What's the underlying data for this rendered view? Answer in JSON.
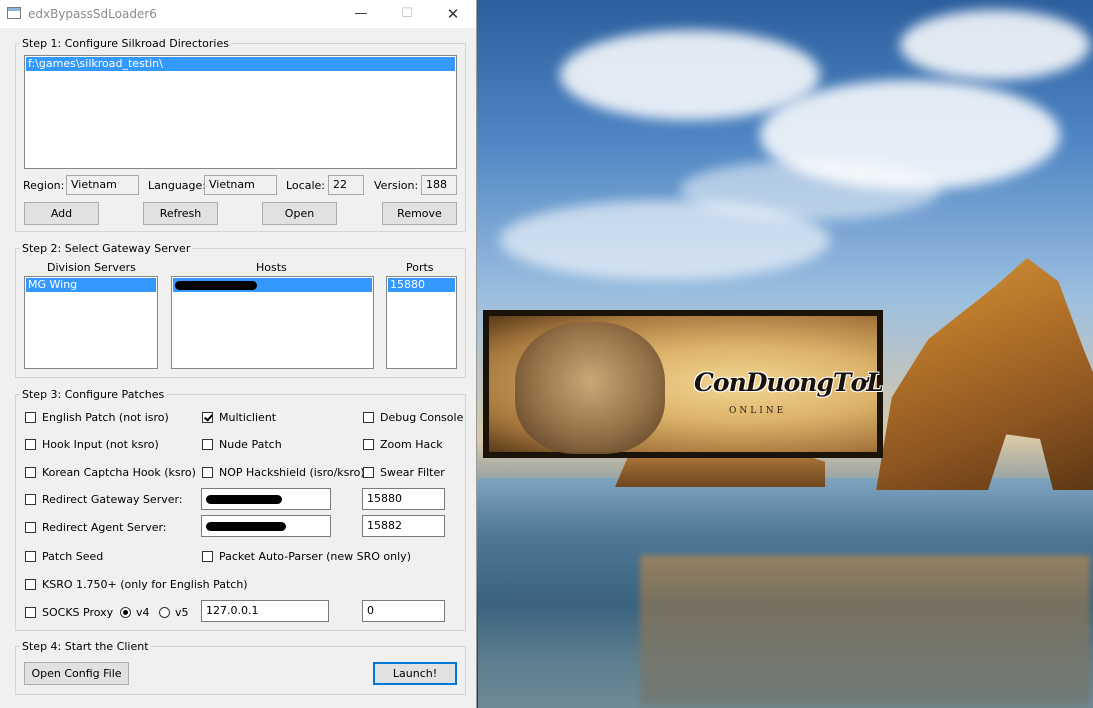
{
  "window": {
    "title": "edxBypassSdLoader6",
    "min_glyph": "—",
    "max_glyph": "☐",
    "close_glyph": "✕"
  },
  "step1": {
    "legend": "Step 1: Configure Silkroad Directories",
    "directories": [
      "f:\\games\\silkroad_testin\\"
    ],
    "region_label": "Region:",
    "region_value": "Vietnam",
    "language_label": "Language:",
    "language_value": "Vietnam",
    "locale_label": "Locale:",
    "locale_value": "22",
    "version_label": "Version:",
    "version_value": "188",
    "add_label": "Add",
    "refresh_label": "Refresh",
    "open_label": "Open",
    "remove_label": "Remove"
  },
  "step2": {
    "legend": "Step 2: Select Gateway Server",
    "division_header": "Division Servers",
    "hosts_header": "Hosts",
    "ports_header": "Ports",
    "divisions": [
      "MG Wing"
    ],
    "ports": [
      "15880"
    ]
  },
  "step3": {
    "legend": "Step 3: Configure Patches",
    "english_patch": "English Patch (not isro)",
    "multiclient": "Multiclient",
    "debug_console": "Debug Console",
    "hook_input": "Hook Input (not ksro)",
    "nude_patch": "Nude Patch",
    "zoom_hack": "Zoom Hack",
    "korean_captcha": "Korean Captcha Hook (ksro)",
    "nop_hackshield": "NOP Hackshield (isro/ksro)",
    "swear_filter": "Swear Filter",
    "redirect_gateway": "Redirect Gateway Server:",
    "gateway_port": "15880",
    "redirect_agent": "Redirect Agent Server:",
    "agent_port": "15882",
    "patch_seed": "Patch Seed",
    "packet_parser": "Packet Auto-Parser (new SRO only)",
    "ksro_version": "KSRO 1.750+ (only for English Patch)",
    "socks_proxy": "SOCKS Proxy",
    "v4": "v4",
    "v5": "v5",
    "proxy_host": "127.0.0.1",
    "proxy_port": "0"
  },
  "step4": {
    "legend": "Step 4: Start the Client",
    "open_config_label": "Open Config File",
    "launch_label": "Launch!"
  },
  "banner": {
    "logo_text": "ConDuongTơLụa",
    "sub_text": "ONLINE"
  }
}
